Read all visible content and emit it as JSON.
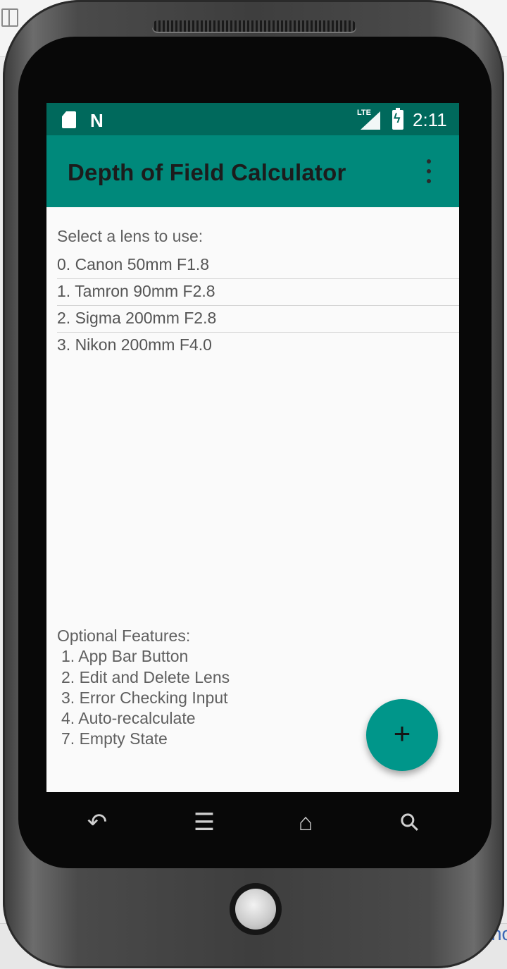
{
  "status_bar": {
    "time": "2:11",
    "network_label": "LTE",
    "icons": [
      "sd-card-icon",
      "n-icon",
      "lte-signal-icon",
      "battery-charging-icon"
    ]
  },
  "app_bar": {
    "title": "Depth of Field Calculator",
    "overflow_icon": "more-vert-icon"
  },
  "lens_section": {
    "prompt": "Select a lens to use:",
    "lenses": [
      "0. Canon 50mm F1.8",
      "1. Tamron 90mm F2.8",
      "2. Sigma 200mm F2.8",
      "3. Nikon 200mm F4.0"
    ]
  },
  "features": {
    "heading": "Optional Features:",
    "items": [
      "1. App Bar Button",
      "2. Edit and Delete Lens",
      "3. Error Checking Input",
      "4. Auto-recalculate",
      "7. Empty State"
    ]
  },
  "fab": {
    "symbol": "+",
    "icon": "add-icon"
  },
  "nav_bar": {
    "back_glyph": "↶",
    "menu_glyph": "☰",
    "home_glyph": "⌂",
    "search_glyph": "⚲"
  },
  "host": {
    "partial_text": "sho"
  },
  "colors": {
    "status_bar": "#00695c",
    "app_bar": "#00897b",
    "fab": "#00968a",
    "screen_bg": "#fafafa"
  }
}
